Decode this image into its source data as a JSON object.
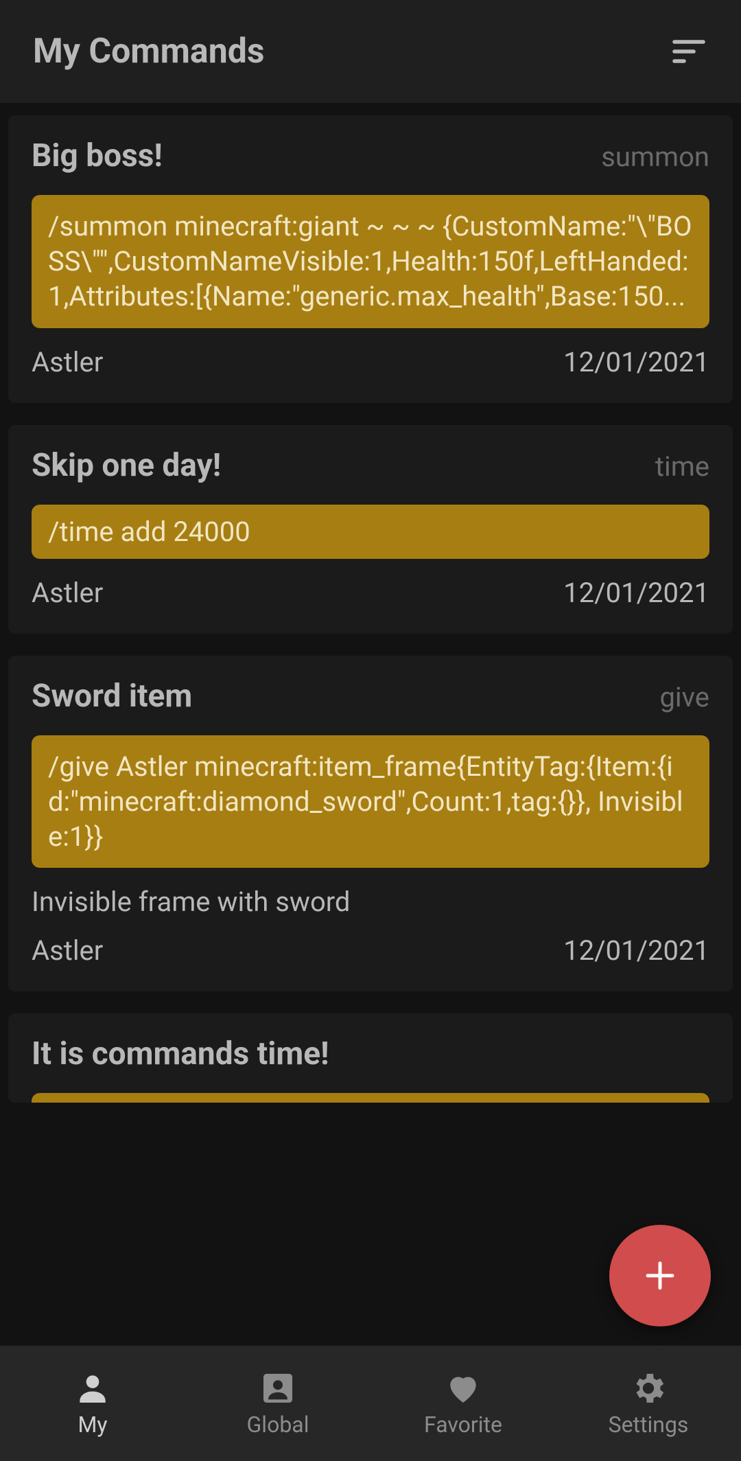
{
  "header": {
    "title": "My Commands"
  },
  "cards": [
    {
      "title": "Big boss!",
      "tag": "summon",
      "code": "/summon minecraft:giant ~ ~ ~ {CustomName:\"\\\"BOSS\\\"\",CustomNameVisible:1,Health:150f,LeftHanded:1,Attributes:[{Name:\"generic.max_health\",Base:150...",
      "desc": "",
      "author": "Astler",
      "date": "12/01/2021"
    },
    {
      "title": "Skip one day!",
      "tag": "time",
      "code": "/time add 24000",
      "desc": "",
      "author": "Astler",
      "date": "12/01/2021"
    },
    {
      "title": "Sword item",
      "tag": "give",
      "code": "/give Astler minecraft:item_frame{EntityTag:{Item:{id:\"minecraft:diamond_sword\",Count:1,tag:{}}, Invisible:1}}",
      "desc": "Invisible frame with sword",
      "author": "Astler",
      "date": "12/01/2021"
    },
    {
      "title": "It is commands time!",
      "tag": "",
      "code": "",
      "desc": "",
      "author": "",
      "date": ""
    }
  ],
  "nav": {
    "my": "My",
    "global": "Global",
    "favorite": "Favorite",
    "settings": "Settings"
  }
}
